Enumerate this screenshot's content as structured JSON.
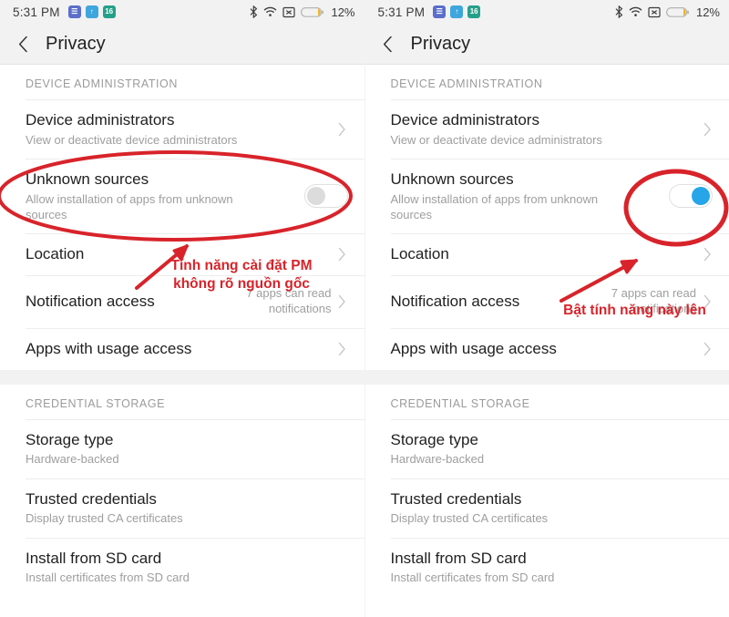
{
  "accent": {
    "red_annotation": "#d8232a",
    "toggle_on": "#26a6e8",
    "toggle_off_knob": "#dcdcdc",
    "status_bar_bg": "#f2f2f2"
  },
  "status_bar": {
    "time": "5:31 PM",
    "app_icons": [
      {
        "name": "blue-app-icon",
        "glyph": "☰",
        "color": "#5b6ec9"
      },
      {
        "name": "upload-app-icon",
        "glyph": "↑",
        "color": "#3ea6dd"
      },
      {
        "name": "green-app-icon",
        "glyph": "16",
        "color": "#25a08a"
      }
    ],
    "icons": [
      "bluetooth-icon",
      "wifi-icon",
      "signal-off-icon",
      "battery-icon"
    ],
    "battery_percent": "12%"
  },
  "header": {
    "back_label": "‹",
    "title": "Privacy"
  },
  "sections": [
    {
      "header": "DEVICE ADMINISTRATION",
      "rows": [
        {
          "name": "device-administrators",
          "title": "Device administrators",
          "subtitle": "View or deactivate device administrators",
          "accessory": "chevron"
        },
        {
          "name": "unknown-sources",
          "title": "Unknown sources",
          "subtitle": "Allow installation of apps from unknown sources",
          "accessory": "toggle"
        },
        {
          "name": "location",
          "title": "Location",
          "subtitle": "",
          "accessory": "chevron"
        },
        {
          "name": "notification-access",
          "title": "Notification access",
          "subtitle": "",
          "value": "7 apps can read notifications",
          "accessory": "chevron"
        },
        {
          "name": "apps-with-usage-access",
          "title": "Apps with usage access",
          "subtitle": "",
          "accessory": "chevron"
        }
      ]
    },
    {
      "header": "CREDENTIAL STORAGE",
      "rows": [
        {
          "name": "storage-type",
          "title": "Storage type",
          "subtitle": "Hardware-backed",
          "accessory": "none"
        },
        {
          "name": "trusted-credentials",
          "title": "Trusted credentials",
          "subtitle": "Display trusted CA certificates",
          "accessory": "none"
        },
        {
          "name": "install-from-sd-card",
          "title": "Install from SD card",
          "subtitle": "Install certificates from SD card",
          "accessory": "none"
        }
      ]
    }
  ],
  "panels": {
    "left": {
      "name": "before-panel",
      "unknown_sources_enabled": false,
      "annotation": "Tính năng cài đặt PM\nkhông rõ nguồn gốc"
    },
    "right": {
      "name": "after-panel",
      "unknown_sources_enabled": true,
      "annotation": "Bật tính năng này lên"
    }
  }
}
